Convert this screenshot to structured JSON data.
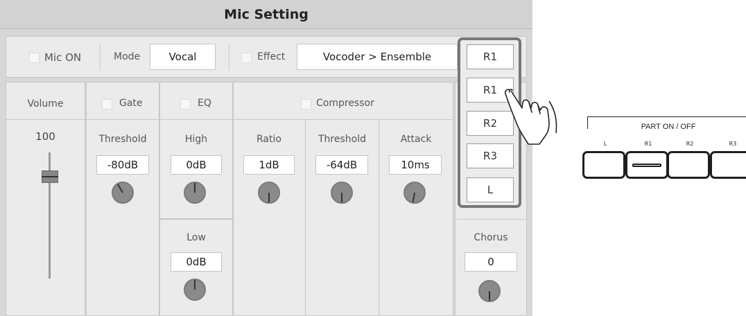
{
  "title": "Mic Setting",
  "top_row": {
    "mic_on_label": "Mic ON",
    "mode_label": "Mode",
    "mode_value": "Vocal",
    "effect_label": "Effect",
    "effect_value": "Vocoder > Ensemble"
  },
  "volume": {
    "label": "Volume",
    "value": "100",
    "slider_level": 1.0
  },
  "gate": {
    "label": "Gate",
    "threshold_label": "Threshold",
    "threshold_value": "-80dB"
  },
  "eq": {
    "label": "EQ",
    "high_label": "High",
    "high_value": "0dB",
    "low_label": "Low",
    "low_value": "0dB"
  },
  "compressor": {
    "label": "Compressor",
    "ratio_label": "Ratio",
    "ratio_value": "1dB",
    "threshold_label": "Threshold",
    "threshold_value": "-64dB",
    "attack_label": "Attack",
    "attack_value": "10ms"
  },
  "chorus": {
    "label": "Chorus",
    "value": "0"
  },
  "part_buttons": {
    "selected": "R1",
    "items": [
      "R1",
      "R1",
      "R2",
      "R3",
      "L"
    ]
  },
  "part_panel": {
    "title": "PART ON / OFF",
    "labels": [
      "L",
      "R1",
      "R2",
      "R3"
    ]
  }
}
